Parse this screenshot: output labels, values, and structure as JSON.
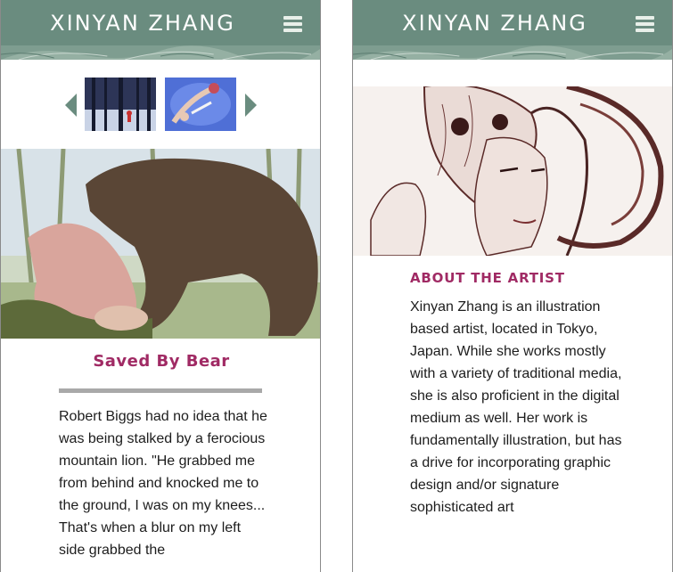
{
  "header": {
    "brand": "XINYAN ZHANG",
    "menu_icon": "hamburger-icon"
  },
  "gallery": {
    "thumbnails": [
      "forest-scene-thumbnail",
      "blue-figures-thumbnail"
    ],
    "prev_icon": "triangle-left-icon",
    "next_icon": "triangle-right-icon",
    "title": "Saved By Bear",
    "description": "Robert Biggs had no idea that he was being stalked by a ferocious mountain lion. \"He grabbed me from behind and knocked me to the ground, I was on my knees... That's when a blur on my left side grabbed the"
  },
  "about": {
    "heading": "ABOUT THE ARTIST",
    "text": "Xinyan Zhang is an illustration based artist, located in Tokyo, Japan. While she works mostly with a variety of traditional media, she is also proficient in the digital medium as well. Her work is fundamentally illustration, but has a drive for incorporating graphic design and/or signature sophisticated art"
  },
  "colors": {
    "header": "#6a8c7f",
    "accent": "#a02a64",
    "rule": "#a9a9a9"
  }
}
